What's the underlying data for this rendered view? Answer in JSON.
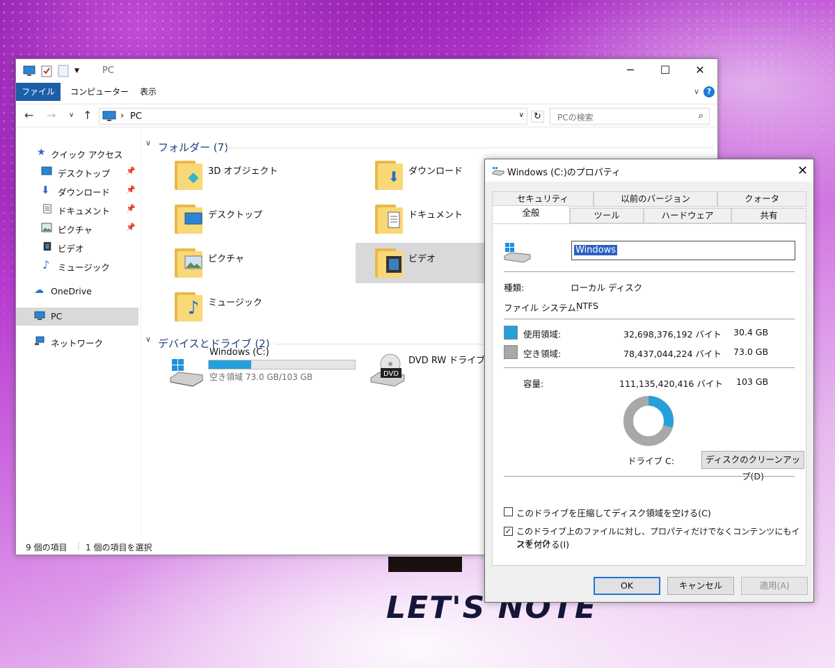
{
  "background": {
    "brand_text": "LET'S NOTE"
  },
  "explorer": {
    "title": "PC",
    "ribbon_tabs": [
      "ファイル",
      "コンピューター",
      "表示"
    ],
    "address": "PC",
    "search_placeholder": "PCの検索",
    "nav": {
      "quick_access": "クイック アクセス",
      "quick_items": [
        {
          "label": "デスクトップ",
          "icon": "desktop-icon"
        },
        {
          "label": "ダウンロード",
          "icon": "download-icon"
        },
        {
          "label": "ドキュメント",
          "icon": "document-icon"
        },
        {
          "label": "ピクチャ",
          "icon": "picture-icon"
        },
        {
          "label": "ビデオ",
          "icon": "video-icon"
        },
        {
          "label": "ミュージック",
          "icon": "music-icon"
        }
      ],
      "onedrive": "OneDrive",
      "pc": "PC",
      "network": "ネットワーク"
    },
    "folders_header": "フォルダー (7)",
    "folders": [
      {
        "label": "3D オブジェクト",
        "icon": "3d-objects-icon"
      },
      {
        "label": "ダウンロード",
        "icon": "download-icon"
      },
      {
        "label": "デスクトップ",
        "icon": "desktop-icon"
      },
      {
        "label": "ドキュメント",
        "icon": "document-icon"
      },
      {
        "label": "ピクチャ",
        "icon": "picture-icon"
      },
      {
        "label": "ビデオ",
        "icon": "video-icon"
      },
      {
        "label": "ミュージック",
        "icon": "music-icon"
      }
    ],
    "devices_header": "デバイスとドライブ (2)",
    "drives": [
      {
        "label": "Windows (C:)",
        "usage_text": "空き領域 73.0 GB/103 GB",
        "used_fraction": 0.29
      },
      {
        "label": "DVD RW ドライブ (D:)"
      }
    ],
    "status": {
      "count": "9 個の項目",
      "selected": "1 個の項目を選択"
    }
  },
  "properties": {
    "title": "Windows (C:)のプロパティ",
    "tabs_top": [
      "セキュリティ",
      "以前のバージョン",
      "クォータ"
    ],
    "tabs_bottom": [
      "全般",
      "ツール",
      "ハードウェア",
      "共有"
    ],
    "volume_name": "Windows",
    "type_label": "種類:",
    "type_value": "ローカル ディスク",
    "fs_label": "ファイル システム:",
    "fs_value": "NTFS",
    "used_label": "使用領域:",
    "used_bytes": "32,698,376,192 バイト",
    "used_size": "30.4 GB",
    "free_label": "空き領域:",
    "free_bytes": "78,437,044,224 バイト",
    "free_size": "73.0 GB",
    "capacity_label": "容量:",
    "capacity_bytes": "111,135,420,416 バイト",
    "capacity_size": "103 GB",
    "drive_label": "ドライブ C:",
    "cleanup_button": "ディスクのクリーンアップ(D)",
    "compress_label": "このドライブを圧縮してディスク領域を空ける(C)",
    "compress_checked": false,
    "index_label_1": "このドライブ上のファイルに対し、プロパティだけでなくコンテンツにもインデック",
    "index_label_2": "スを付ける(I)",
    "index_checked": true,
    "ok": "OK",
    "cancel": "キャンセル",
    "apply": "適用(A)",
    "colors": {
      "used": "#26a0da",
      "free": "#a8a8a8"
    },
    "used_fraction": 0.294
  }
}
